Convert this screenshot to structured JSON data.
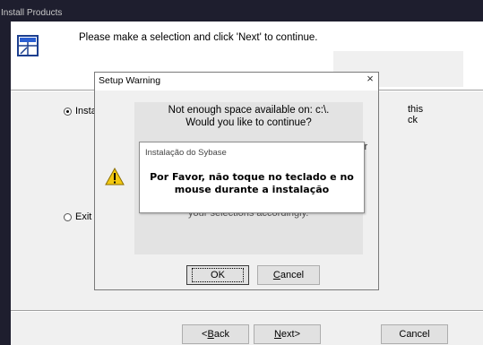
{
  "installer": {
    "title": "Install Products",
    "header_text": "Please make a selection and click 'Next' to continue.",
    "options": {
      "install_label": "Insta",
      "exit_label": "Exit",
      "install_tail": "this\nck"
    },
    "buttons": {
      "back": {
        "mnemonic": "B",
        "rest": "ack",
        "prefix": "<"
      },
      "next": {
        "mnemonic": "N",
        "rest": "ext>"
      },
      "cancel": "Cancel"
    }
  },
  "warning_dialog": {
    "title": "Setup Warning",
    "close_glyph": "×",
    "message_line1": "Not enough space available on:  c:\\.",
    "message_line2": "Would you like to continue?",
    "obscured_r": "ir",
    "obscured_t": "t",
    "obscured_line": "your selections accordingly.",
    "ok_label": "OK",
    "cancel": {
      "mnemonic": "C",
      "rest": "ancel"
    },
    "icon": "warning-triangle-icon"
  },
  "sybase_toast": {
    "title": "Instalação do Sybase",
    "message_line1": "Por Favor, não toque no teclado e no",
    "message_line2": "mouse durante a instalação"
  },
  "colors": {
    "background": "#1e1e2e",
    "dialog_face": "#f0f0f0",
    "warning_yellow": "#f2c811"
  }
}
